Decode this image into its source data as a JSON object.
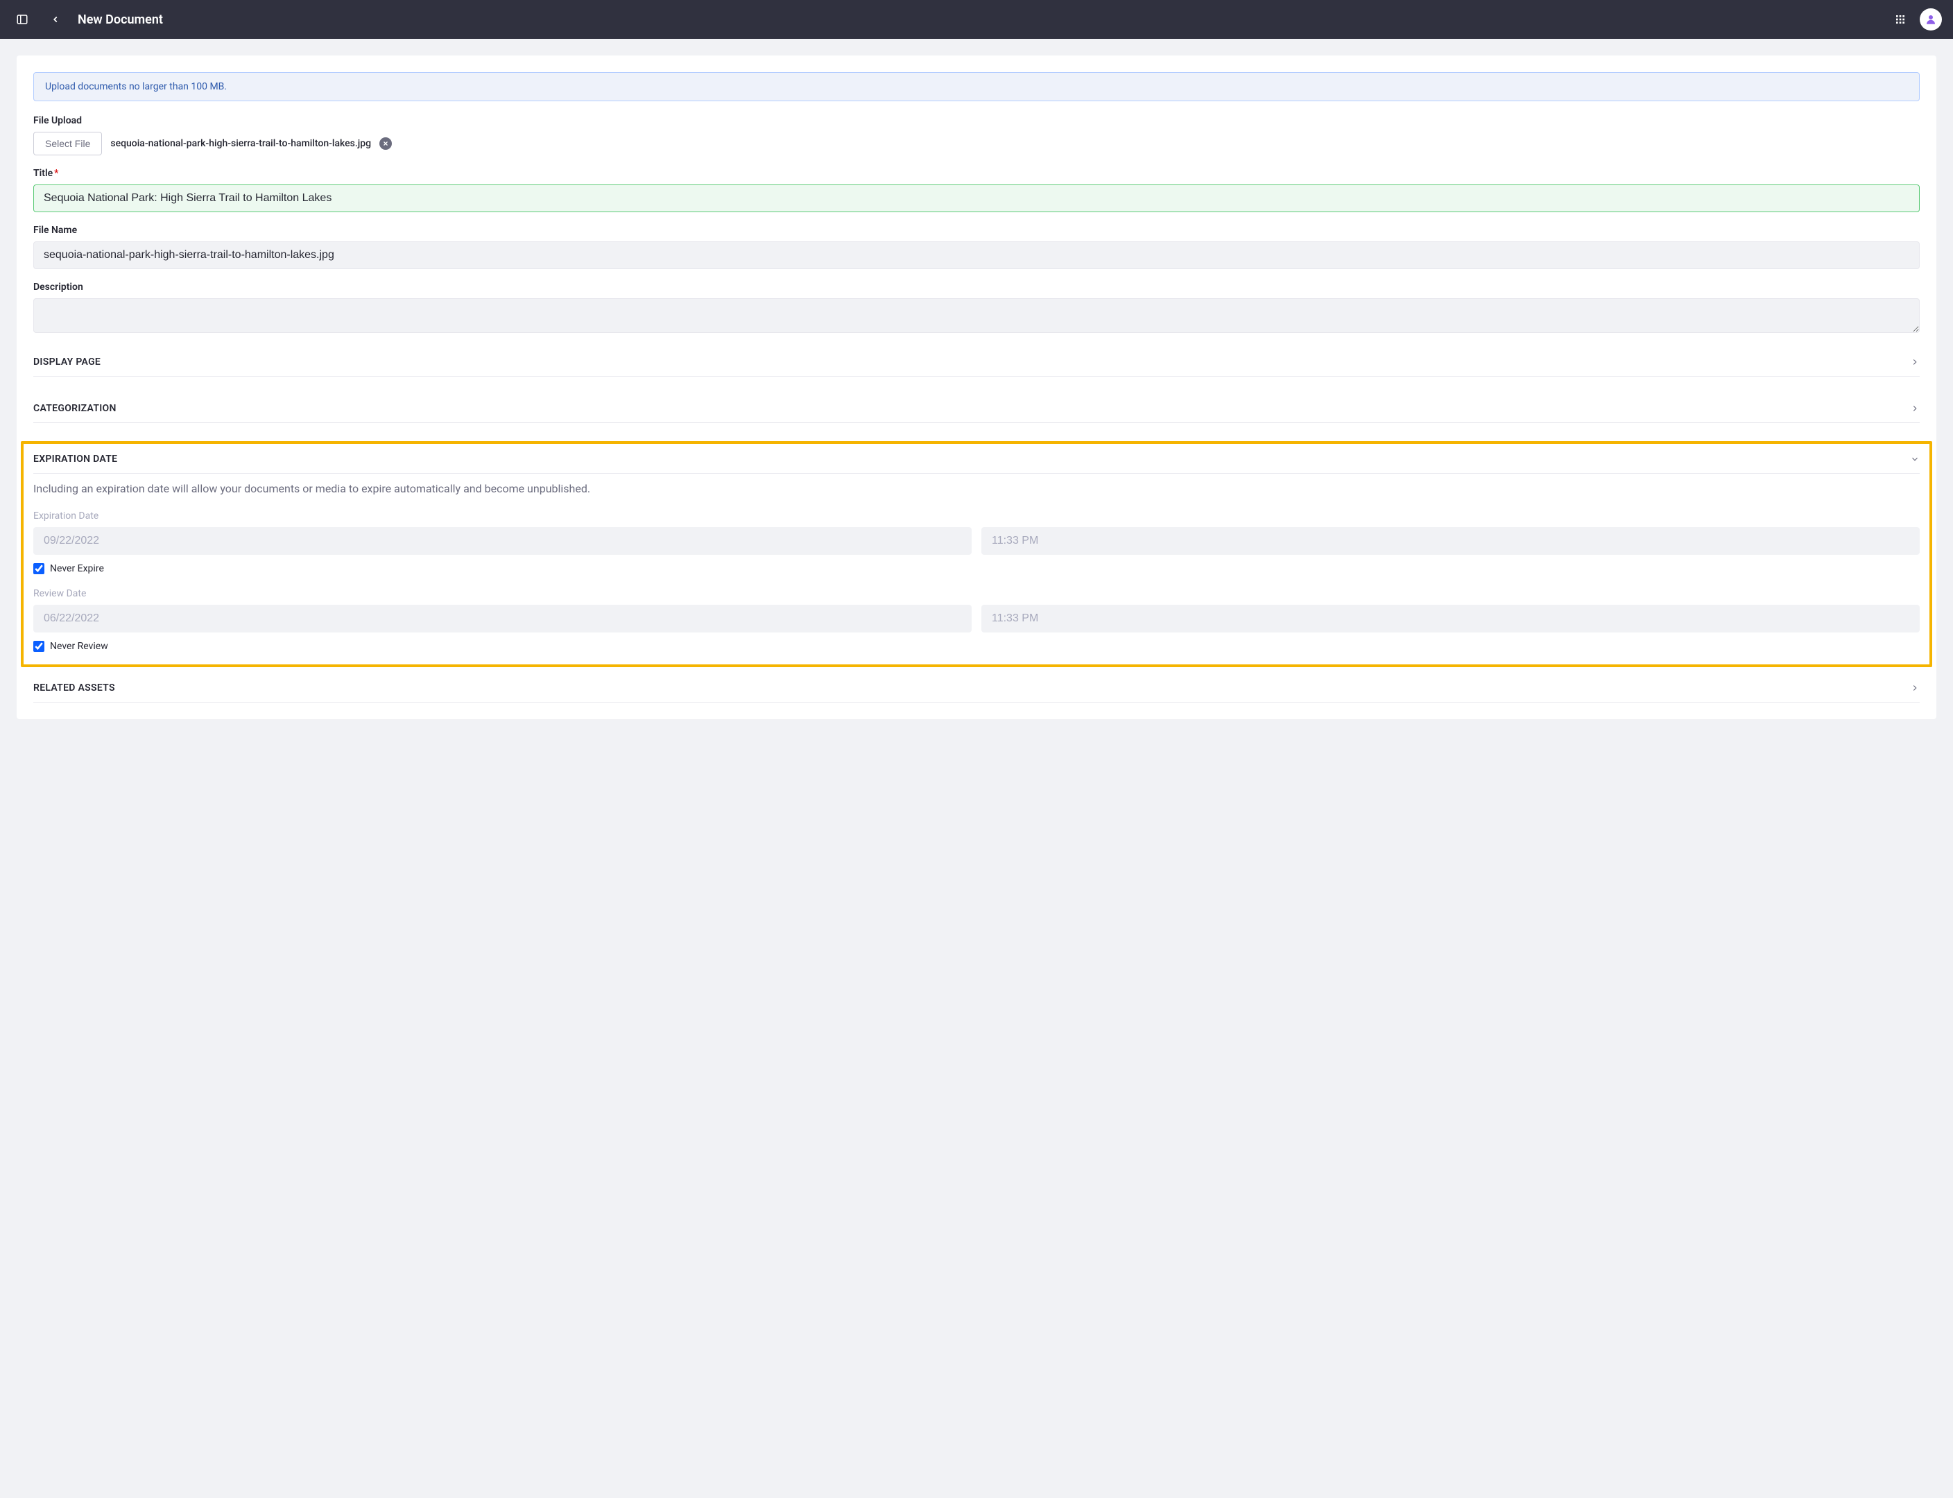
{
  "topbar": {
    "title": "New Document"
  },
  "banner": {
    "text": "Upload documents no larger than 100 MB."
  },
  "fileUpload": {
    "label": "File Upload",
    "button": "Select File",
    "filename": "sequoia-national-park-high-sierra-trail-to-hamilton-lakes.jpg"
  },
  "title": {
    "label": "Title",
    "value": "Sequoia National Park: High Sierra Trail to Hamilton Lakes"
  },
  "filename": {
    "label": "File Name",
    "value": "sequoia-national-park-high-sierra-trail-to-hamilton-lakes.jpg"
  },
  "description": {
    "label": "Description",
    "value": ""
  },
  "sections": {
    "displayPage": "DISPLAY PAGE",
    "categorization": "CATEGORIZATION",
    "expirationDate": "EXPIRATION DATE",
    "relatedAssets": "RELATED ASSETS"
  },
  "expiration": {
    "helper": "Including an expiration date will allow your documents or media to expire automatically and become unpublished.",
    "expirationDateLabel": "Expiration Date",
    "expirationDateValue": "09/22/2022",
    "expirationTimeValue": "11:33 PM",
    "neverExpireLabel": "Never Expire",
    "neverExpireChecked": true,
    "reviewDateLabel": "Review Date",
    "reviewDateValue": "06/22/2022",
    "reviewTimeValue": "11:33 PM",
    "neverReviewLabel": "Never Review",
    "neverReviewChecked": true
  }
}
